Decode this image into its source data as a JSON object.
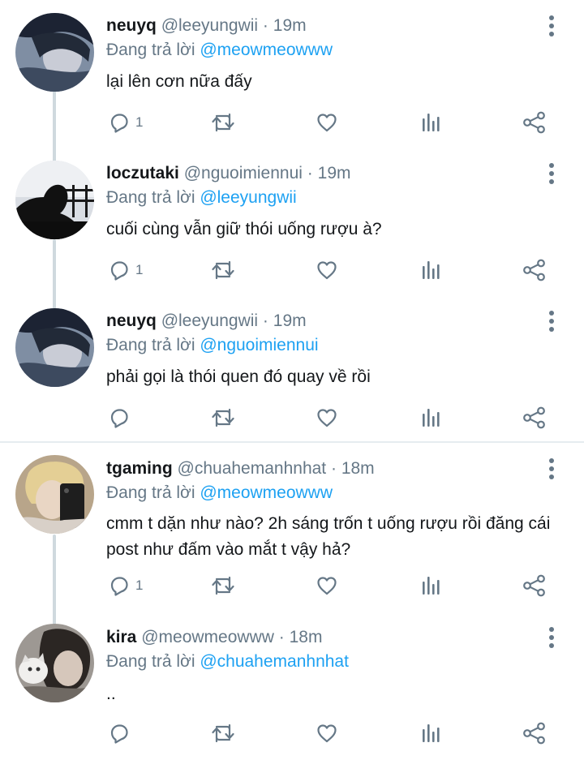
{
  "colors": {
    "accent": "#1da1f2",
    "text": "#14171a",
    "muted": "#657786",
    "icon": "#657786",
    "connector": "#cfd9de"
  },
  "replying_prefix": "Đang trả lời",
  "tweets": [
    {
      "name": "neuyq",
      "handle": "@leeyungwii",
      "dot": "·",
      "time": "19m",
      "reply_to": "@meowmeowww",
      "text": "lại lên cơn nữa đấy",
      "reply_count": "1"
    },
    {
      "name": "loczutaki",
      "handle": "@nguoimiennui",
      "dot": "·",
      "time": "19m",
      "reply_to": "@leeyungwii",
      "text": "cuối cùng vẫn giữ thói uống rượu à?",
      "reply_count": "1"
    },
    {
      "name": "neuyq",
      "handle": "@leeyungwii",
      "dot": "·",
      "time": "19m",
      "reply_to": "@nguoimiennui",
      "text": "phải gọi là thói quen đó quay về rồi",
      "reply_count": ""
    },
    {
      "name": "tgaming",
      "handle": "@chuahemanhnhat",
      "dot": "·",
      "time": "18m",
      "reply_to": "@meowmeowww",
      "text": "cmm t dặn như nào? 2h sáng trốn t uống rượu rồi đăng cái post như đấm vào mắt t vậy hả?",
      "reply_count": "1"
    },
    {
      "name": "kira",
      "handle": "@meowmeowww",
      "dot": "·",
      "time": "18m",
      "reply_to": "@chuahemanhnhat",
      "text": "..",
      "reply_count": ""
    }
  ]
}
